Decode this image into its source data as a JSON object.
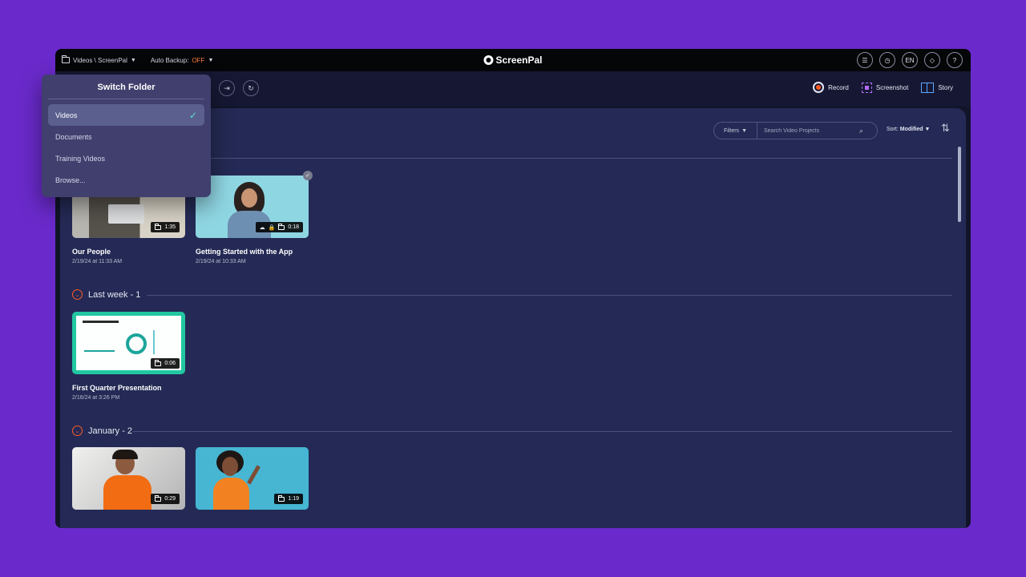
{
  "app": {
    "logo": "ScreenPal",
    "path_label": "Videos \\ ScreenPal",
    "auto_backup_label": "Auto Backup:",
    "auto_backup_state": "OFF",
    "language": "EN",
    "help": "?"
  },
  "toolbar": {
    "record_label": "Record",
    "screenshot_label": "Screenshot",
    "story_label": "Story"
  },
  "filters": {
    "label": "Filters",
    "search_placeholder": "Search Video Projects",
    "sort_prefix": "Sort:",
    "sort_value": "Modified"
  },
  "folder_menu": {
    "title": "Switch Folder",
    "options": [
      "Videos",
      "Documents",
      "Training Videos",
      "Browse..."
    ]
  },
  "sections": [
    {
      "title": "",
      "count": "",
      "videos": [
        {
          "title": "Our People",
          "date": "2/19/24 at 11:33 AM",
          "duration": "1:35"
        },
        {
          "title": "Getting Started with the App",
          "date": "2/19/24 at 10:33 AM",
          "duration": "0:18"
        }
      ]
    },
    {
      "title": "Last week",
      "count": " - 1",
      "videos": [
        {
          "title": "First Quarter Presentation",
          "date": "2/16/24 at 3:26 PM",
          "duration": "0:06"
        }
      ]
    },
    {
      "title": "January",
      "count": " - 2",
      "videos": [
        {
          "duration": "0:29"
        },
        {
          "duration": "1:19"
        }
      ]
    }
  ],
  "colors": {
    "background": "#6a2acb",
    "accent": "#ff5a24",
    "checkmark": "#5ee0c9"
  }
}
